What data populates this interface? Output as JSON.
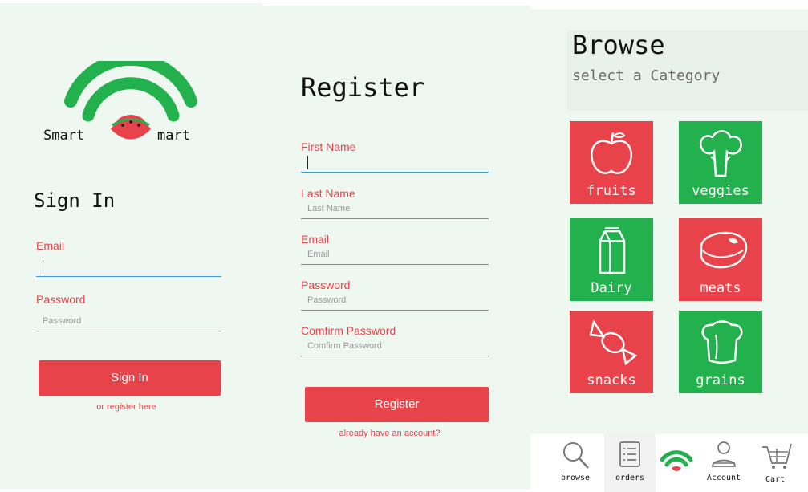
{
  "signin": {
    "logo_left": "Smart",
    "logo_right": "mart",
    "title": "Sign In",
    "email_label": "Email",
    "password_label": "Password",
    "password_placeholder": "Password",
    "button": "Sign In",
    "link": "or register here"
  },
  "register": {
    "title": "Register",
    "first_name_label": "First Name",
    "last_name_label": "Last Name",
    "last_name_placeholder": "Last Name",
    "email_label": "Email",
    "email_placeholder": "Email",
    "password_label": "Password",
    "password_placeholder": "Password",
    "confirm_label": "Comfirm Password",
    "confirm_placeholder": "Comfirm Password",
    "button": "Register",
    "link": "already have an account?"
  },
  "browse": {
    "title": "Browse",
    "subtitle": "select a Category",
    "categories": [
      {
        "label": "fruits",
        "color": "red",
        "icon": "apple-icon"
      },
      {
        "label": "veggies",
        "color": "green",
        "icon": "broccoli-icon"
      },
      {
        "label": "Dairy",
        "color": "green",
        "icon": "milk-carton-icon"
      },
      {
        "label": "meats",
        "color": "red",
        "icon": "steak-icon"
      },
      {
        "label": "snacks",
        "color": "red",
        "icon": "candy-icon"
      },
      {
        "label": "grains",
        "color": "green",
        "icon": "bread-icon"
      }
    ]
  },
  "nav": {
    "items": [
      {
        "label": "browse",
        "icon": "search-icon"
      },
      {
        "label": "orders",
        "icon": "list-icon"
      },
      {
        "label": "",
        "icon": "smartmart-logo-icon"
      },
      {
        "label": "Account",
        "icon": "user-icon"
      },
      {
        "label": "Cart",
        "icon": "cart-icon"
      }
    ]
  },
  "colors": {
    "accent_red": "#e8434b",
    "accent_green": "#22b14c",
    "background": "#eef7f0",
    "focus_blue": "#3b9ed8"
  }
}
